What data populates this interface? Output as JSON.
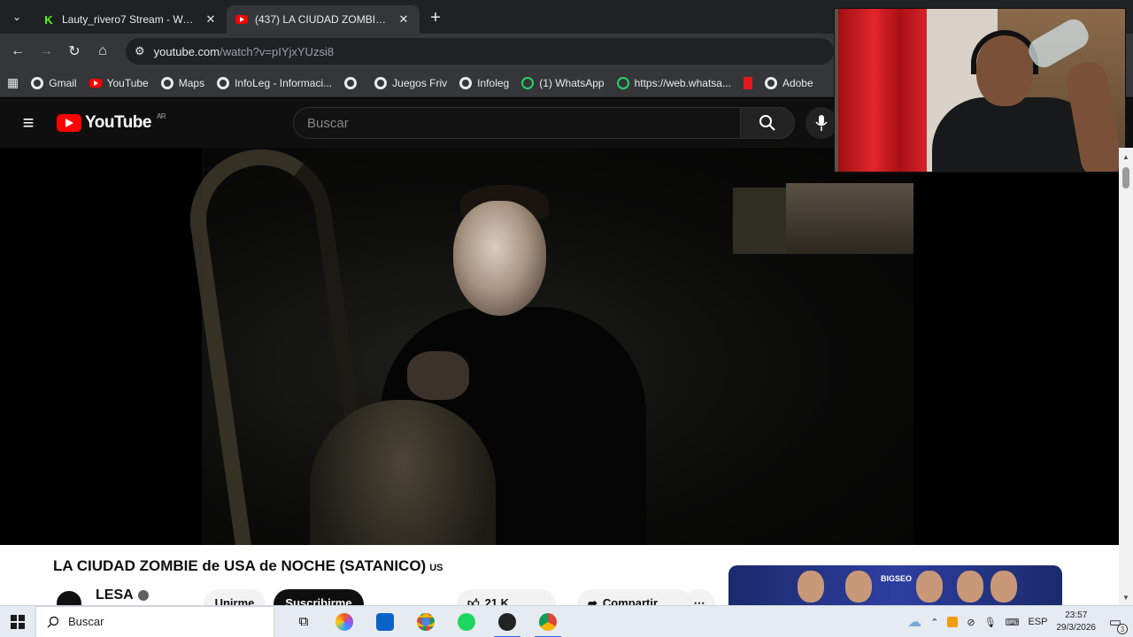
{
  "browser": {
    "tabs": [
      {
        "title": "Lauty_rivero7 Stream - Watch L",
        "favicon": "kick-icon",
        "active": false
      },
      {
        "title": "(437) LA CIUDAD ZOMBIE de U",
        "favicon": "youtube-icon",
        "active": true
      }
    ],
    "address": {
      "host": "youtube.com",
      "path": "/watch?v=pIYjxYUzsi8"
    },
    "bookmarks": [
      {
        "label": "Gmail",
        "icon": "globe-icon"
      },
      {
        "label": "YouTube",
        "icon": "youtube-icon"
      },
      {
        "label": "Maps",
        "icon": "globe-icon"
      },
      {
        "label": "InfoLeg - Informaci...",
        "icon": "globe-icon"
      },
      {
        "label": "",
        "icon": "globe-icon"
      },
      {
        "label": "Juegos Friv",
        "icon": "globe-icon"
      },
      {
        "label": "Infoleg",
        "icon": "globe-icon"
      },
      {
        "label": "(1) WhatsApp",
        "icon": "whatsapp-icon"
      },
      {
        "label": "https://web.whatsa...",
        "icon": "whatsapp-icon"
      },
      {
        "label": "",
        "icon": "adobe-icon"
      },
      {
        "label": "Adobe",
        "icon": "globe-icon"
      }
    ]
  },
  "youtube": {
    "logo_text": "YouTube",
    "region": "AR",
    "search_placeholder": "Buscar",
    "video_title": "LA CIUDAD ZOMBIE de USA de NOCHE (SATANICO)",
    "title_flag": "US",
    "channel_name": "LESA",
    "join_label": "Unirme",
    "subscribe_label": "Suscribirme",
    "likes": "21 K",
    "share_label": "Compartir",
    "ad_brand": "BIGSEO"
  },
  "taskbar": {
    "search_placeholder": "Buscar",
    "language": "ESP",
    "time": "23:57",
    "date": "29/3/2026",
    "notification_count": "3"
  },
  "colors": {
    "youtube_red": "#ff0000",
    "browser_dark": "#202124",
    "toolbar": "#35363a"
  }
}
